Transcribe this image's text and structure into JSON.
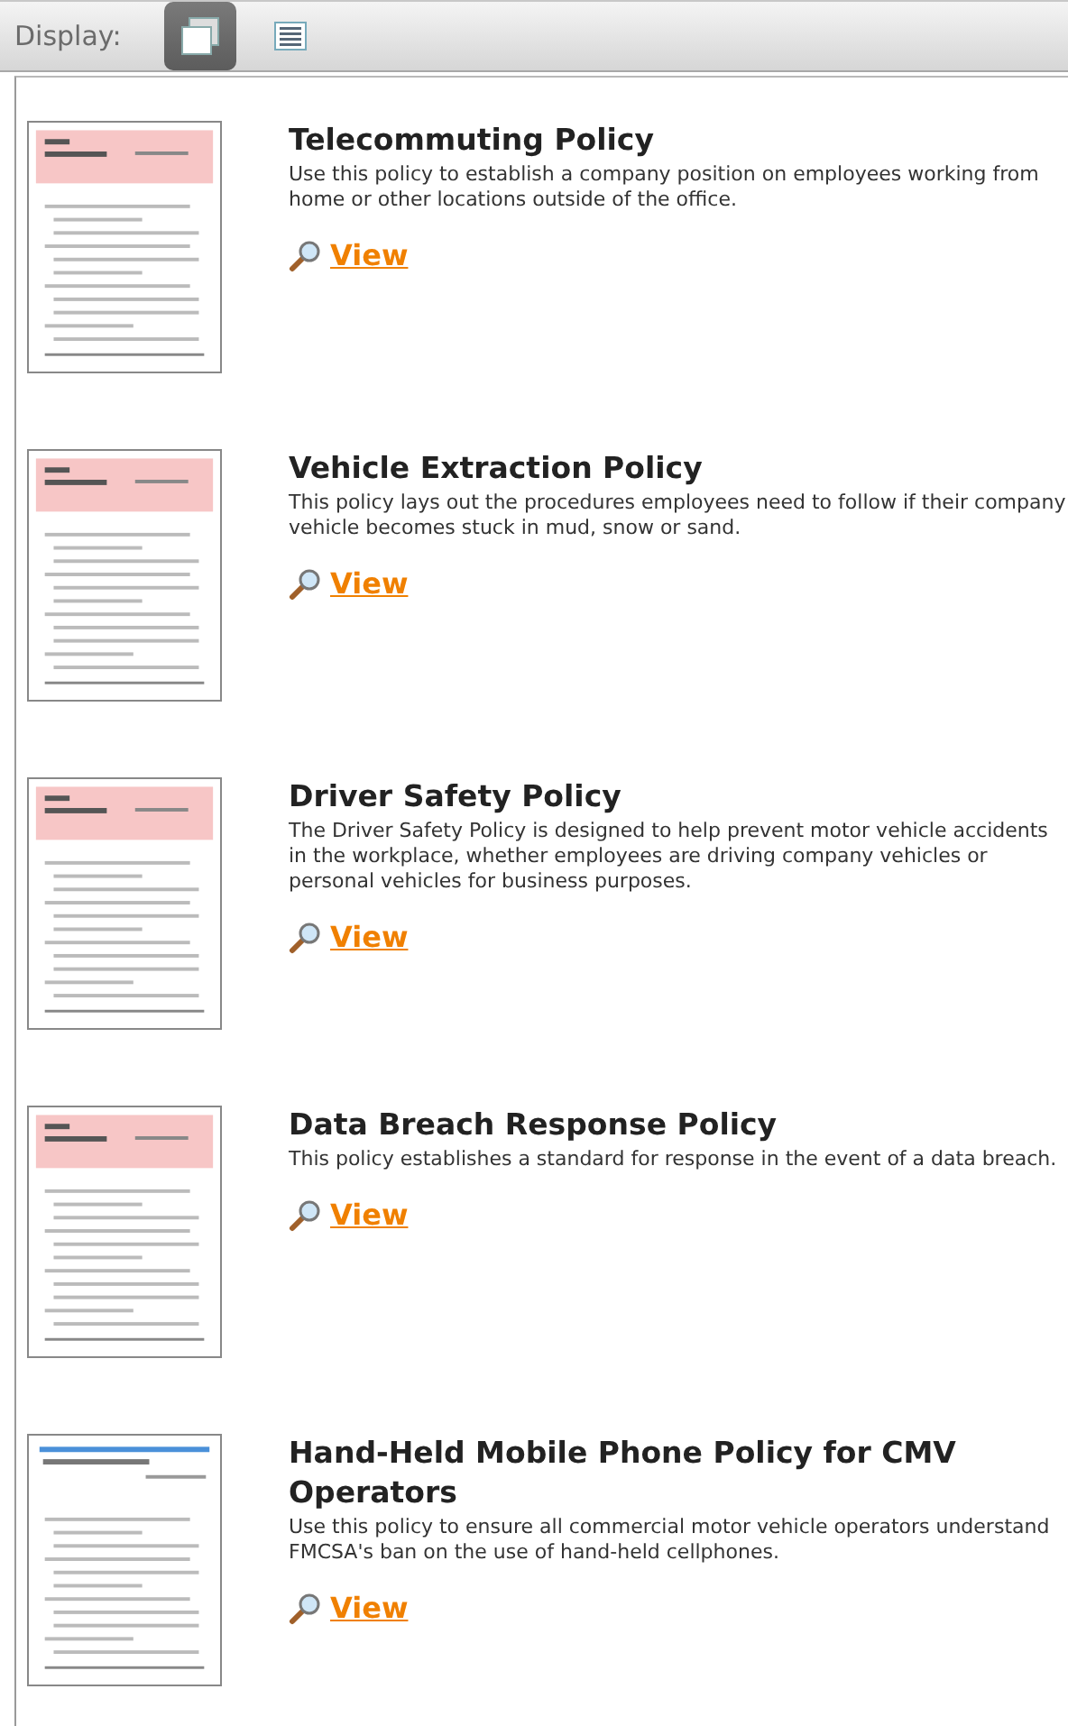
{
  "toolbar": {
    "label": "Display:",
    "modes": [
      {
        "kind": "tiles",
        "selected": true
      },
      {
        "kind": "list",
        "selected": false
      }
    ]
  },
  "policies": [
    {
      "title": "Telecommuting Policy",
      "description": "Use this policy to establish a company position on employees working from home or other locations outside of the office.",
      "link": "View"
    },
    {
      "title": "Vehicle Extraction Policy",
      "description": "This policy lays out the procedures employees need to follow if their company vehicle becomes stuck in mud, snow or sand.",
      "link": "View"
    },
    {
      "title": "Driver Safety Policy",
      "description": "The Driver Safety Policy is designed to help prevent motor vehicle accidents in the workplace, whether employees are driving company vehicles or personal vehicles for business purposes.",
      "link": "View"
    },
    {
      "title": "Data Breach Response Policy",
      "description": "This policy establishes a standard for response in the event of a data breach.",
      "link": "View"
    },
    {
      "title": "Hand-Held Mobile Phone Policy for CMV Operators",
      "description": "Use this policy to ensure all commercial motor vehicle operators understand FMCSA's ban on the use of hand-held cellphones.",
      "link": "View"
    }
  ]
}
